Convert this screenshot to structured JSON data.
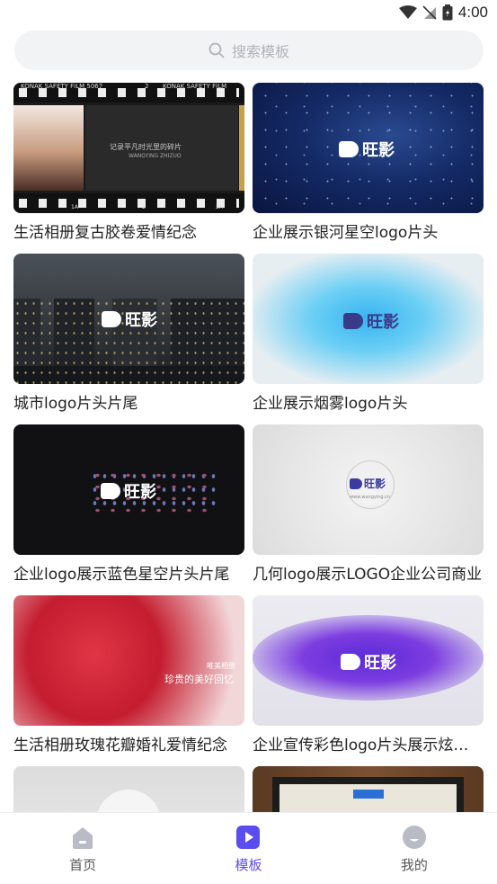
{
  "status_bar": {
    "time": "4:00"
  },
  "search": {
    "placeholder": "搜索模板"
  },
  "templates": [
    {
      "title": "生活相册复古胶卷爱情纪念",
      "overlay_lines": [
        "KONAK SAFETY FILM 5067",
        "2",
        "KONAK SAFETY FILM",
        "记录平凡时光里的碎片",
        "WANGYING ZHIZUO",
        "1A",
        "2",
        "2A"
      ]
    },
    {
      "title": "企业展示银河星空logo片头",
      "logo_text": "旺影"
    },
    {
      "title": "城市logo片头片尾",
      "logo_text": "旺影"
    },
    {
      "title": "企业展示烟雾logo片头",
      "logo_text": "旺影"
    },
    {
      "title": "企业logo展示蓝色星空片头片尾",
      "logo_text": "旺影"
    },
    {
      "title": "几何logo展示LOGO企业公司商业",
      "logo_text": "旺影",
      "sub_text": "www.wangying.cn"
    },
    {
      "title": "生活相册玫瑰花瓣婚礼爱情纪念",
      "overlay_lines": [
        "唯美相册",
        "珍贵的美好回忆"
      ]
    },
    {
      "title": "企业宣传彩色logo片头展示炫酷特效",
      "logo_text": "旺影"
    },
    {
      "title": ""
    },
    {
      "title": ""
    }
  ],
  "bottom_nav": {
    "items": [
      {
        "label": "首页",
        "active": false
      },
      {
        "label": "模板",
        "active": true
      },
      {
        "label": "我的",
        "active": false
      }
    ]
  },
  "colors": {
    "accent": "#5b4cf0",
    "search_bg": "#f2f3f5",
    "nav_inactive": "#b9bcc4"
  }
}
